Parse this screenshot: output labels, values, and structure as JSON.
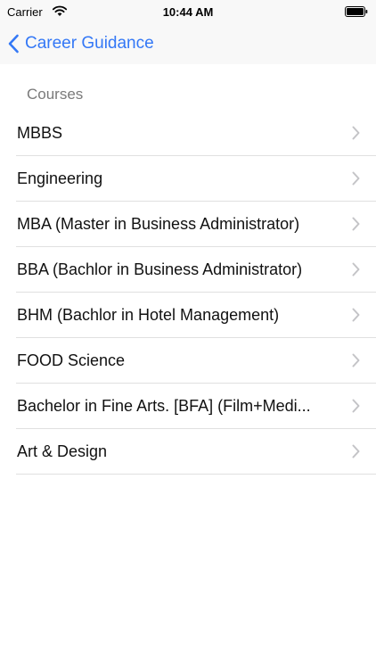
{
  "status_bar": {
    "carrier": "Carrier",
    "time": "10:44 AM",
    "wifi_icon": "wifi-icon",
    "battery_icon": "battery-icon"
  },
  "nav": {
    "back_label": "Career Guidance",
    "back_icon": "chevron-left-icon",
    "accent_color": "#3478f6"
  },
  "section": {
    "title": "Courses"
  },
  "courses": [
    {
      "label": "MBBS"
    },
    {
      "label": "Engineering"
    },
    {
      "label": "MBA (Master in Business Administrator)"
    },
    {
      "label": "BBA (Bachlor  in Business Administrator)"
    },
    {
      "label": "BHM (Bachlor in Hotel Management)"
    },
    {
      "label": "FOOD Science"
    },
    {
      "label": "Bachelor in Fine Arts. [BFA]  (Film+Medi..."
    },
    {
      "label": "Art & Design"
    }
  ]
}
